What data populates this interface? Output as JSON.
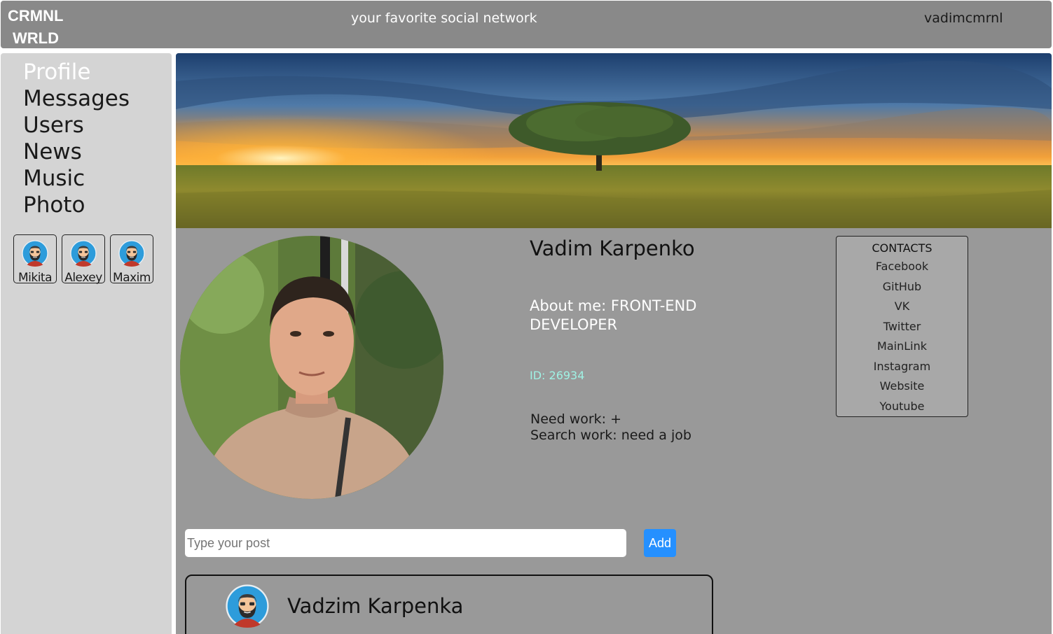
{
  "header": {
    "logo_line1": "CRMNL",
    "logo_line2": "WRLD",
    "tagline": "your favorite social network",
    "username": "vadimcmrnl"
  },
  "nav": {
    "items": [
      {
        "label": "Profile",
        "active": true
      },
      {
        "label": "Messages"
      },
      {
        "label": "Users"
      },
      {
        "label": "News"
      },
      {
        "label": "Music"
      },
      {
        "label": "Photo"
      }
    ]
  },
  "friends": [
    {
      "name": "Mikita"
    },
    {
      "name": "Alexey"
    },
    {
      "name": "Maxim"
    }
  ],
  "profile": {
    "full_name": "Vadim Karpenko",
    "about": "About me: FRONT-END DEVELOPER",
    "id_text": "ID: 26934",
    "need_work": "Need work: +",
    "search_work": "Search work: need a job"
  },
  "contacts": {
    "title": "CONTACTS",
    "links": [
      "Facebook",
      "GitHub",
      "VK",
      "Twitter",
      "MainLink",
      "Instagram",
      "Website",
      "Youtube"
    ]
  },
  "post_form": {
    "placeholder": "Type your post",
    "value": "",
    "add_label": "Add"
  },
  "posts": [
    {
      "author": "Vadzim Karpenka"
    }
  ],
  "colors": {
    "header_bg": "#898989",
    "sidebar_bg": "#d4d4d4",
    "main_bg": "#999999",
    "accent_button": "#2590ff",
    "id_text": "#9ff2e4"
  }
}
